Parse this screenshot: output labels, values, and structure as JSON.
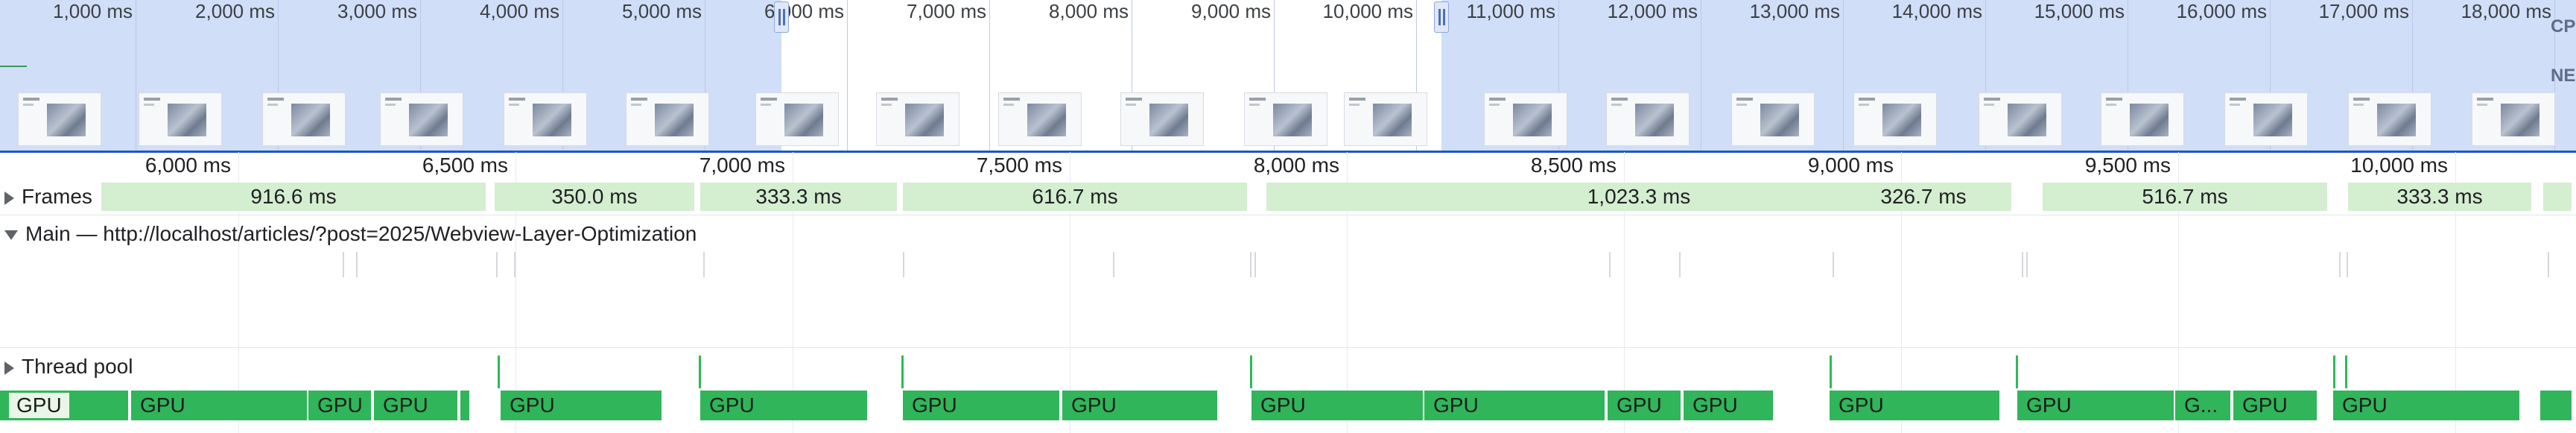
{
  "overview": {
    "time_labels": [
      "1,000 ms",
      "2,000 ms",
      "3,000 ms",
      "4,000 ms",
      "5,000 ms",
      "6,000 ms",
      "7,000 ms",
      "8,000 ms",
      "9,000 ms",
      "10,000 ms",
      "11,000 ms",
      "12,000 ms",
      "13,000 ms",
      "14,000 ms",
      "15,000 ms",
      "16,000 ms",
      "17,000 ms",
      "18,000 ms"
    ],
    "cpu_tag": "CP",
    "net_tag": "NE"
  },
  "ruler": {
    "labels": [
      "6,000 ms",
      "6,500 ms",
      "7,000 ms",
      "7,500 ms",
      "8,000 ms",
      "8,500 ms",
      "9,000 ms",
      "9,500 ms",
      "10,000 ms"
    ]
  },
  "frames_track": {
    "title": "Frames",
    "frames": [
      "916.6 ms",
      "350.0 ms",
      "333.3 ms",
      "616.7 ms",
      "1,023.3 ms",
      "326.7 ms",
      "516.7 ms",
      "333.3 ms"
    ]
  },
  "main_track": {
    "title": "Main — http://localhost/articles/?post=2025/Webview-Layer-Optimization"
  },
  "thread_pool": {
    "title": "Thread pool"
  },
  "gpu_track": {
    "blocks": [
      "GPU",
      "GPU",
      "GPU",
      "GPU",
      "GPU",
      "GPU",
      "GPU",
      "GPU",
      "GPU",
      "GPU",
      "GPU",
      "GPU",
      "GPU",
      "GPU",
      "G...",
      "GPU",
      "GPU"
    ]
  },
  "colors": {
    "frame_fill": "#d4eed0",
    "gpu_fill": "#30b55a",
    "selection_shade": "#aac2f2",
    "accent": "#1a57c8"
  }
}
